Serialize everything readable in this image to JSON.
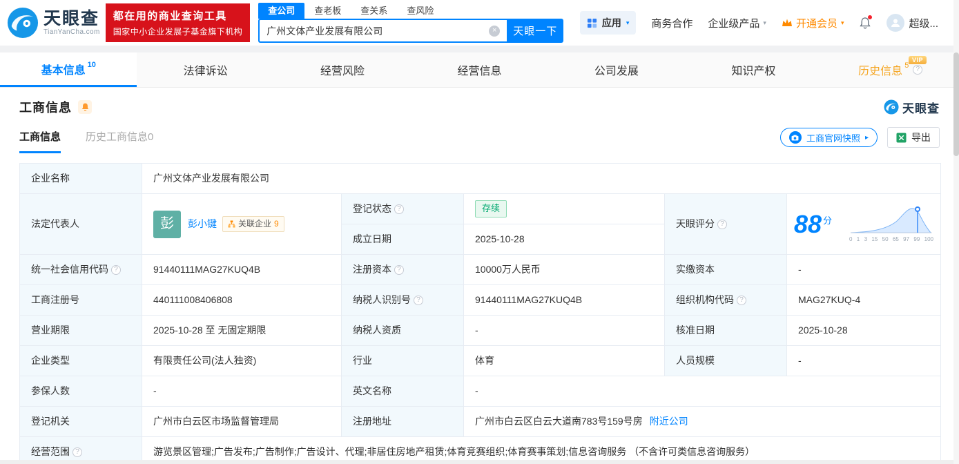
{
  "colors": {
    "primary": "#0084ff",
    "brand-red": "#d7121b",
    "orange": "#ff8a00",
    "gold-tab": "#f5a623",
    "green": "#00a870",
    "green-bg": "#e9f8f0",
    "label-bg": "#f2f9fd",
    "border": "#e7ecf3",
    "link": "#0084ff"
  },
  "icons": {
    "help": "?",
    "caret": "▾",
    "arrow": "▸",
    "clear": "×"
  },
  "header": {
    "brand": {
      "name": "天眼查",
      "domain": "TianYanCha.com"
    },
    "promo": {
      "line1": "都在用的商业查询工具",
      "line2": "国家中小企业发展子基金旗下机构"
    },
    "search_tabs": [
      {
        "label": "查公司"
      },
      {
        "label": "查老板"
      },
      {
        "label": "查关系"
      },
      {
        "label": "查风险"
      }
    ],
    "search": {
      "value": "广州文体产业发展有限公司",
      "button": "天眼一下"
    },
    "nav": {
      "apps": "应用",
      "cooperation": "商务合作",
      "enterprise": "企业级产品",
      "vip": "开通会员",
      "user": "超级..."
    }
  },
  "tabs": [
    {
      "label": "基本信息",
      "badge": "10"
    },
    {
      "label": "法律诉讼"
    },
    {
      "label": "经营风险"
    },
    {
      "label": "经营信息"
    },
    {
      "label": "公司发展"
    },
    {
      "label": "知识产权"
    },
    {
      "label": "历史信息",
      "badge": "5",
      "vip": "VIP"
    }
  ],
  "section": {
    "title": "工商信息",
    "brand": "天眼查",
    "subtabs": [
      {
        "label": "工商信息"
      },
      {
        "label": "历史工商信息",
        "count": "0"
      }
    ],
    "snapshot": "工商官网快照",
    "export": "导出"
  },
  "info": {
    "company_name": {
      "label": "企业名称",
      "value": "广州文体产业发展有限公司"
    },
    "legal_rep": {
      "label": "法定代表人",
      "avatar": "彭",
      "name": "彭小键",
      "related": "关联企业",
      "related_count": "9"
    },
    "reg_status": {
      "label": "登记状态",
      "value": "存续"
    },
    "establish_date": {
      "label": "成立日期",
      "value": "2025-10-28"
    },
    "score": {
      "label": "天眼评分",
      "value": "88",
      "unit": "分",
      "ticks": [
        "0",
        "1",
        "3",
        "15",
        "50",
        "65",
        "97",
        "99",
        "100"
      ]
    },
    "credit_code": {
      "label": "统一社会信用代码",
      "value": "91440111MAG27KUQ4B"
    },
    "reg_capital": {
      "label": "注册资本",
      "value": "10000万人民币"
    },
    "paid_capital": {
      "label": "实缴资本",
      "value": "-"
    },
    "reg_number": {
      "label": "工商注册号",
      "value": "440111008406808"
    },
    "taxpayer_id": {
      "label": "纳税人识别号",
      "value": "91440111MAG27KUQ4B"
    },
    "org_code": {
      "label": "组织机构代码",
      "value": "MAG27KUQ-4"
    },
    "business_term": {
      "label": "营业期限",
      "value": "2025-10-28 至 无固定期限"
    },
    "taxpayer_quality": {
      "label": "纳税人资质",
      "value": "-"
    },
    "approval_date": {
      "label": "核准日期",
      "value": "2025-10-28"
    },
    "company_type": {
      "label": "企业类型",
      "value": "有限责任公司(法人独资)"
    },
    "industry": {
      "label": "行业",
      "value": "体育"
    },
    "staff_size": {
      "label": "人员规模",
      "value": "-"
    },
    "insured_count": {
      "label": "参保人数",
      "value": "-"
    },
    "english_name": {
      "label": "英文名称",
      "value": "-"
    },
    "reg_authority": {
      "label": "登记机关",
      "value": "广州市白云区市场监督管理局"
    },
    "reg_address": {
      "label": "注册地址",
      "value": "广州市白云区白云大道南783号159号房",
      "nearby": "附近公司"
    },
    "business_scope": {
      "label": "经营范围",
      "value": "游览景区管理;广告发布;广告制作;广告设计、代理;非居住房地产租赁;体育竞赛组织;体育赛事策划;信息咨询服务 （不含许可类信息咨询服务）"
    }
  }
}
